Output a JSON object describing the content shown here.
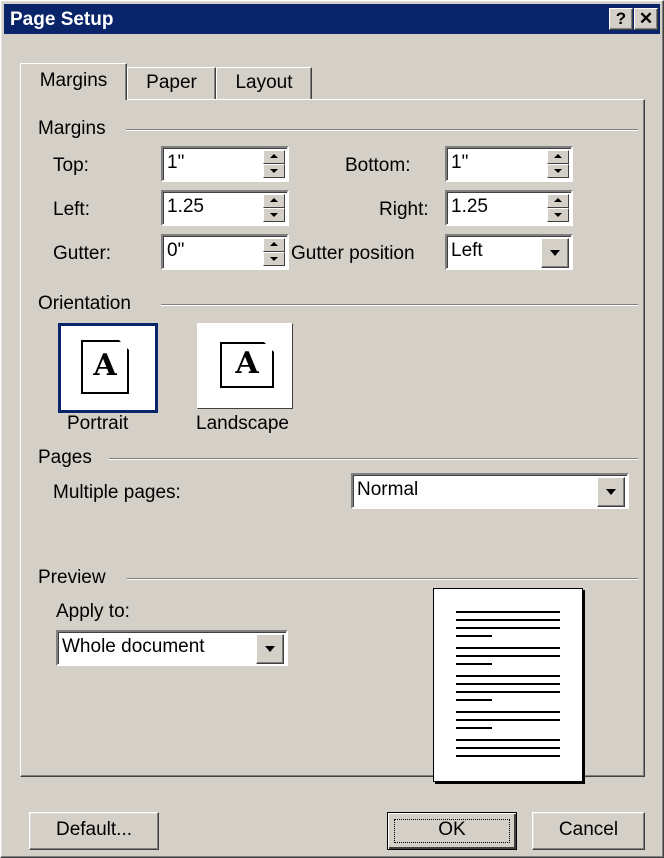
{
  "window": {
    "title": "Page Setup",
    "help_button": "?",
    "close_button": "✕"
  },
  "tabs": [
    {
      "label": "Margins"
    },
    {
      "label": "Paper"
    },
    {
      "label": "Layout"
    }
  ],
  "margins": {
    "group_label": "Margins",
    "top": {
      "label": "Top:",
      "value": "1\""
    },
    "left": {
      "label": "Left:",
      "value": "1.25"
    },
    "gutter": {
      "label": "Gutter:",
      "value": "0\""
    },
    "bottom": {
      "label": "Bottom:",
      "value": "1\""
    },
    "right": {
      "label": "Right:",
      "value": "1.25"
    },
    "gutter_position": {
      "label": "Gutter position",
      "value": "Left"
    }
  },
  "orientation": {
    "group_label": "Orientation",
    "portrait_label": "Portrait",
    "landscape_label": "Landscape",
    "icon_letter": "A",
    "selected": "Portrait"
  },
  "pages": {
    "group_label": "Pages",
    "multiple_pages_label": "Multiple pages:",
    "multiple_pages_value": "Normal"
  },
  "preview": {
    "group_label": "Preview",
    "apply_to_label": "Apply to:",
    "apply_to_value": "Whole document"
  },
  "buttons": {
    "default_label": "Default...",
    "ok_label": "OK",
    "cancel_label": "Cancel"
  },
  "colors": {
    "titlebar": "#0a246a",
    "face": "#d4d0c8"
  }
}
